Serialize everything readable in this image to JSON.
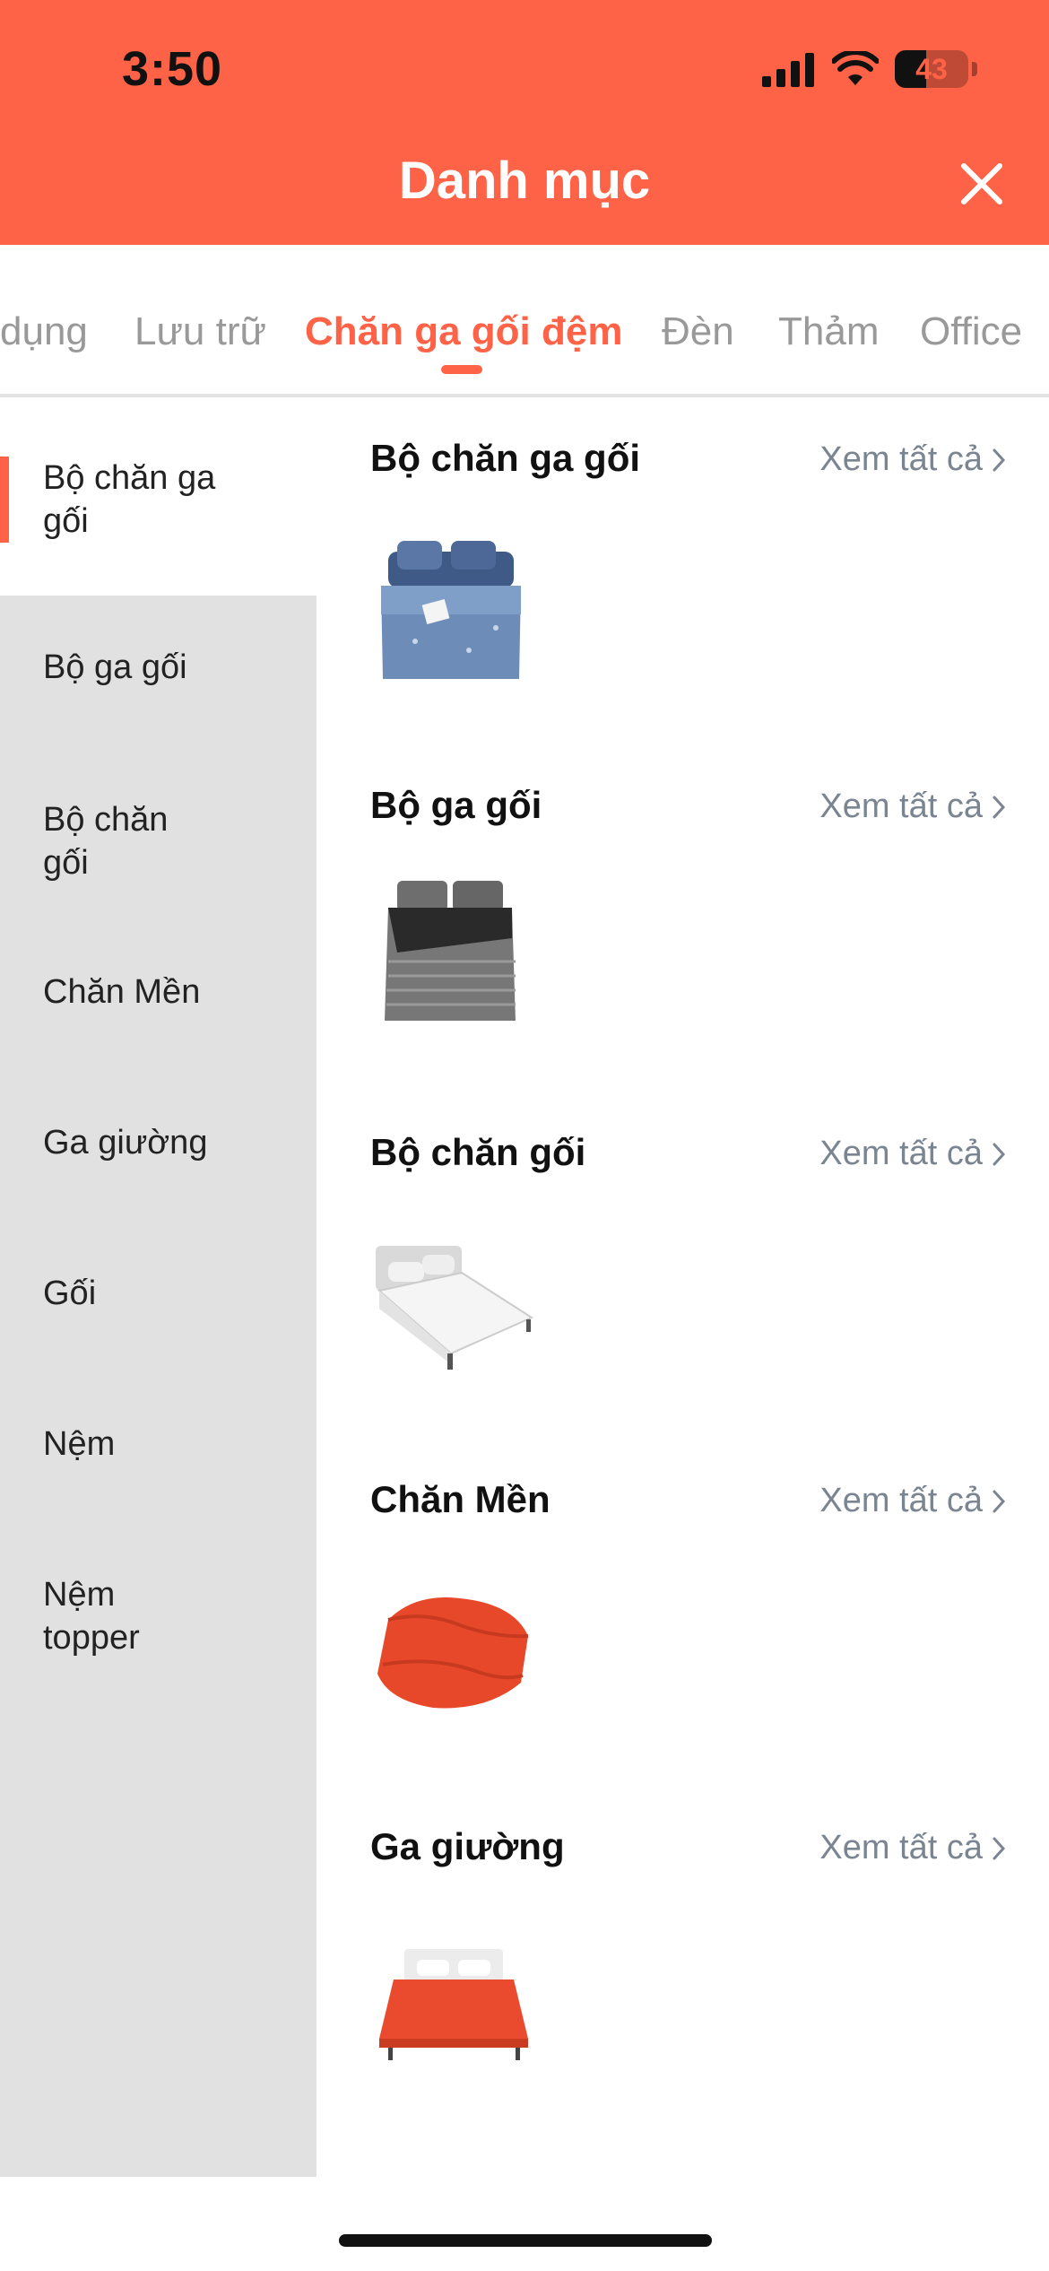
{
  "status_bar": {
    "time": "3:50",
    "battery": "43",
    "battery_fraction": 0.43
  },
  "header": {
    "title": "Danh mục"
  },
  "tabs": [
    {
      "label": "dụng"
    },
    {
      "label": "Lưu trữ"
    },
    {
      "label": "Chăn ga gối đệm",
      "active": true
    },
    {
      "label": "Đèn"
    },
    {
      "label": "Thảm"
    },
    {
      "label": "Office"
    }
  ],
  "sidebar": {
    "items": [
      {
        "label": "Bộ chăn ga gối",
        "active": true
      },
      {
        "label": "Bộ ga gối"
      },
      {
        "label": "Bộ chăn gối"
      },
      {
        "label": "Chăn Mền"
      },
      {
        "label": "Ga giường"
      },
      {
        "label": "Gối"
      },
      {
        "label": "Nệm"
      },
      {
        "label": "Nệm topper"
      }
    ]
  },
  "sections": [
    {
      "title": "Bộ chăn ga gối",
      "see_all": "Xem tất cả",
      "image": "blue-bedding-set"
    },
    {
      "title": "Bộ ga gối",
      "see_all": "Xem tất cả",
      "image": "gray-striped-bed-sheet-set"
    },
    {
      "title": "Bộ chăn gối",
      "see_all": "Xem tất cả",
      "image": "white-bed"
    },
    {
      "title": "Chăn Mền",
      "see_all": "Xem tất cả",
      "image": "orange-folded-comforter"
    },
    {
      "title": "Ga giường",
      "see_all": "Xem tất cả",
      "image": "orange-bed-sheet"
    }
  ],
  "colors": {
    "accent": "#ff6347",
    "sidebar_bg": "#e1e1e1",
    "muted_text": "#7a8591"
  }
}
